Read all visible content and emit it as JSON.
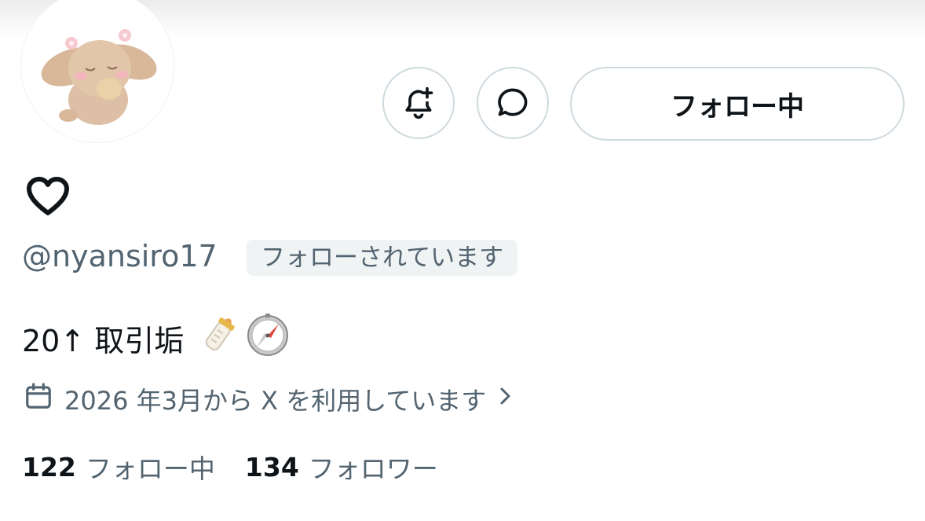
{
  "profile": {
    "heart_glyph": "♡",
    "handle": "@nyansiro17",
    "follows_you_badge": "フォローされています",
    "bio_text": "20↑ 取引垢",
    "bio_emojis": [
      "baby-bottle",
      "compass"
    ],
    "joined_text": "2026 年3月から X を利用しています",
    "following_count": "122",
    "following_label": "フォロー中",
    "followers_count": "134",
    "followers_label": "フォロワー"
  },
  "actions": {
    "notify_icon": "bell-plus-icon",
    "message_icon": "message-bubble-icon",
    "follow_button_label": "フォロー中"
  },
  "colors": {
    "text_primary": "#0f1419",
    "text_secondary": "#536471",
    "border": "#cfd9de",
    "badge_bg": "#eff3f4"
  }
}
